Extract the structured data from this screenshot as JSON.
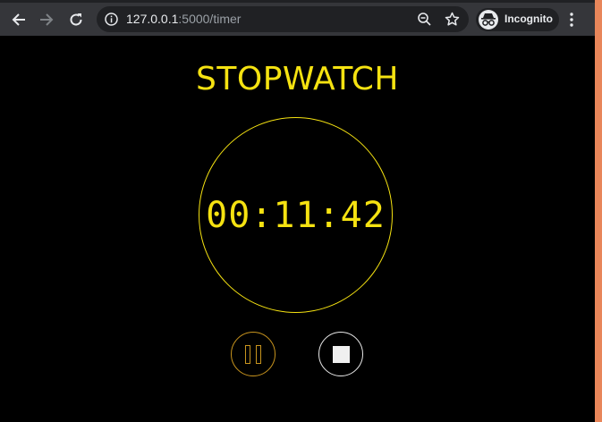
{
  "browser": {
    "url_host": "127.0.0.1",
    "url_rest": ":5000/timer",
    "profile_label": "Incognito",
    "icons": {
      "back": "back-arrow-icon",
      "forward": "forward-arrow-icon",
      "reload": "reload-icon",
      "info": "info-icon",
      "zoom": "zoom-out-icon",
      "bookmark": "star-icon",
      "incognito": "incognito-icon",
      "menu": "kebab-menu-icon"
    }
  },
  "page": {
    "title": "STOPWATCH",
    "time": "00:11:42",
    "controls": {
      "pause": "pause-icon",
      "stop": "stop-icon"
    }
  },
  "colors": {
    "accent": "#f5e211",
    "pause_border": "#c8941e",
    "stop_border": "#e8e8e8",
    "background": "#000000",
    "toolbar": "#35363a"
  }
}
